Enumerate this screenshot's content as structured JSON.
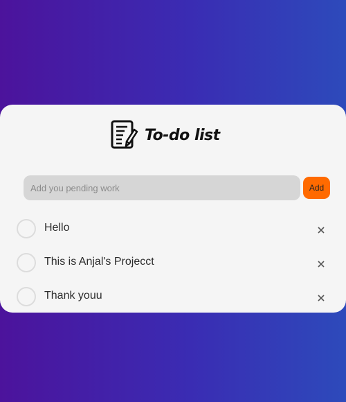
{
  "app": {
    "title": "To-do list",
    "icon": "notepad-pencil-icon"
  },
  "input": {
    "placeholder": "Add you pending work",
    "value": "",
    "add_label": "Add"
  },
  "todos": [
    {
      "text": "Hello",
      "done": false
    },
    {
      "text": "This is Anjal's Projecct",
      "done": false
    },
    {
      "text": "Thank youu",
      "done": false
    }
  ],
  "colors": {
    "background_start": "#4c139c",
    "background_end": "#2d4abb",
    "card": "#f5f5f5",
    "input": "#d6d6d6",
    "accent": "#ff6a00"
  },
  "icons": {
    "checkbox": "circle-outline-icon",
    "delete": "close-icon"
  }
}
